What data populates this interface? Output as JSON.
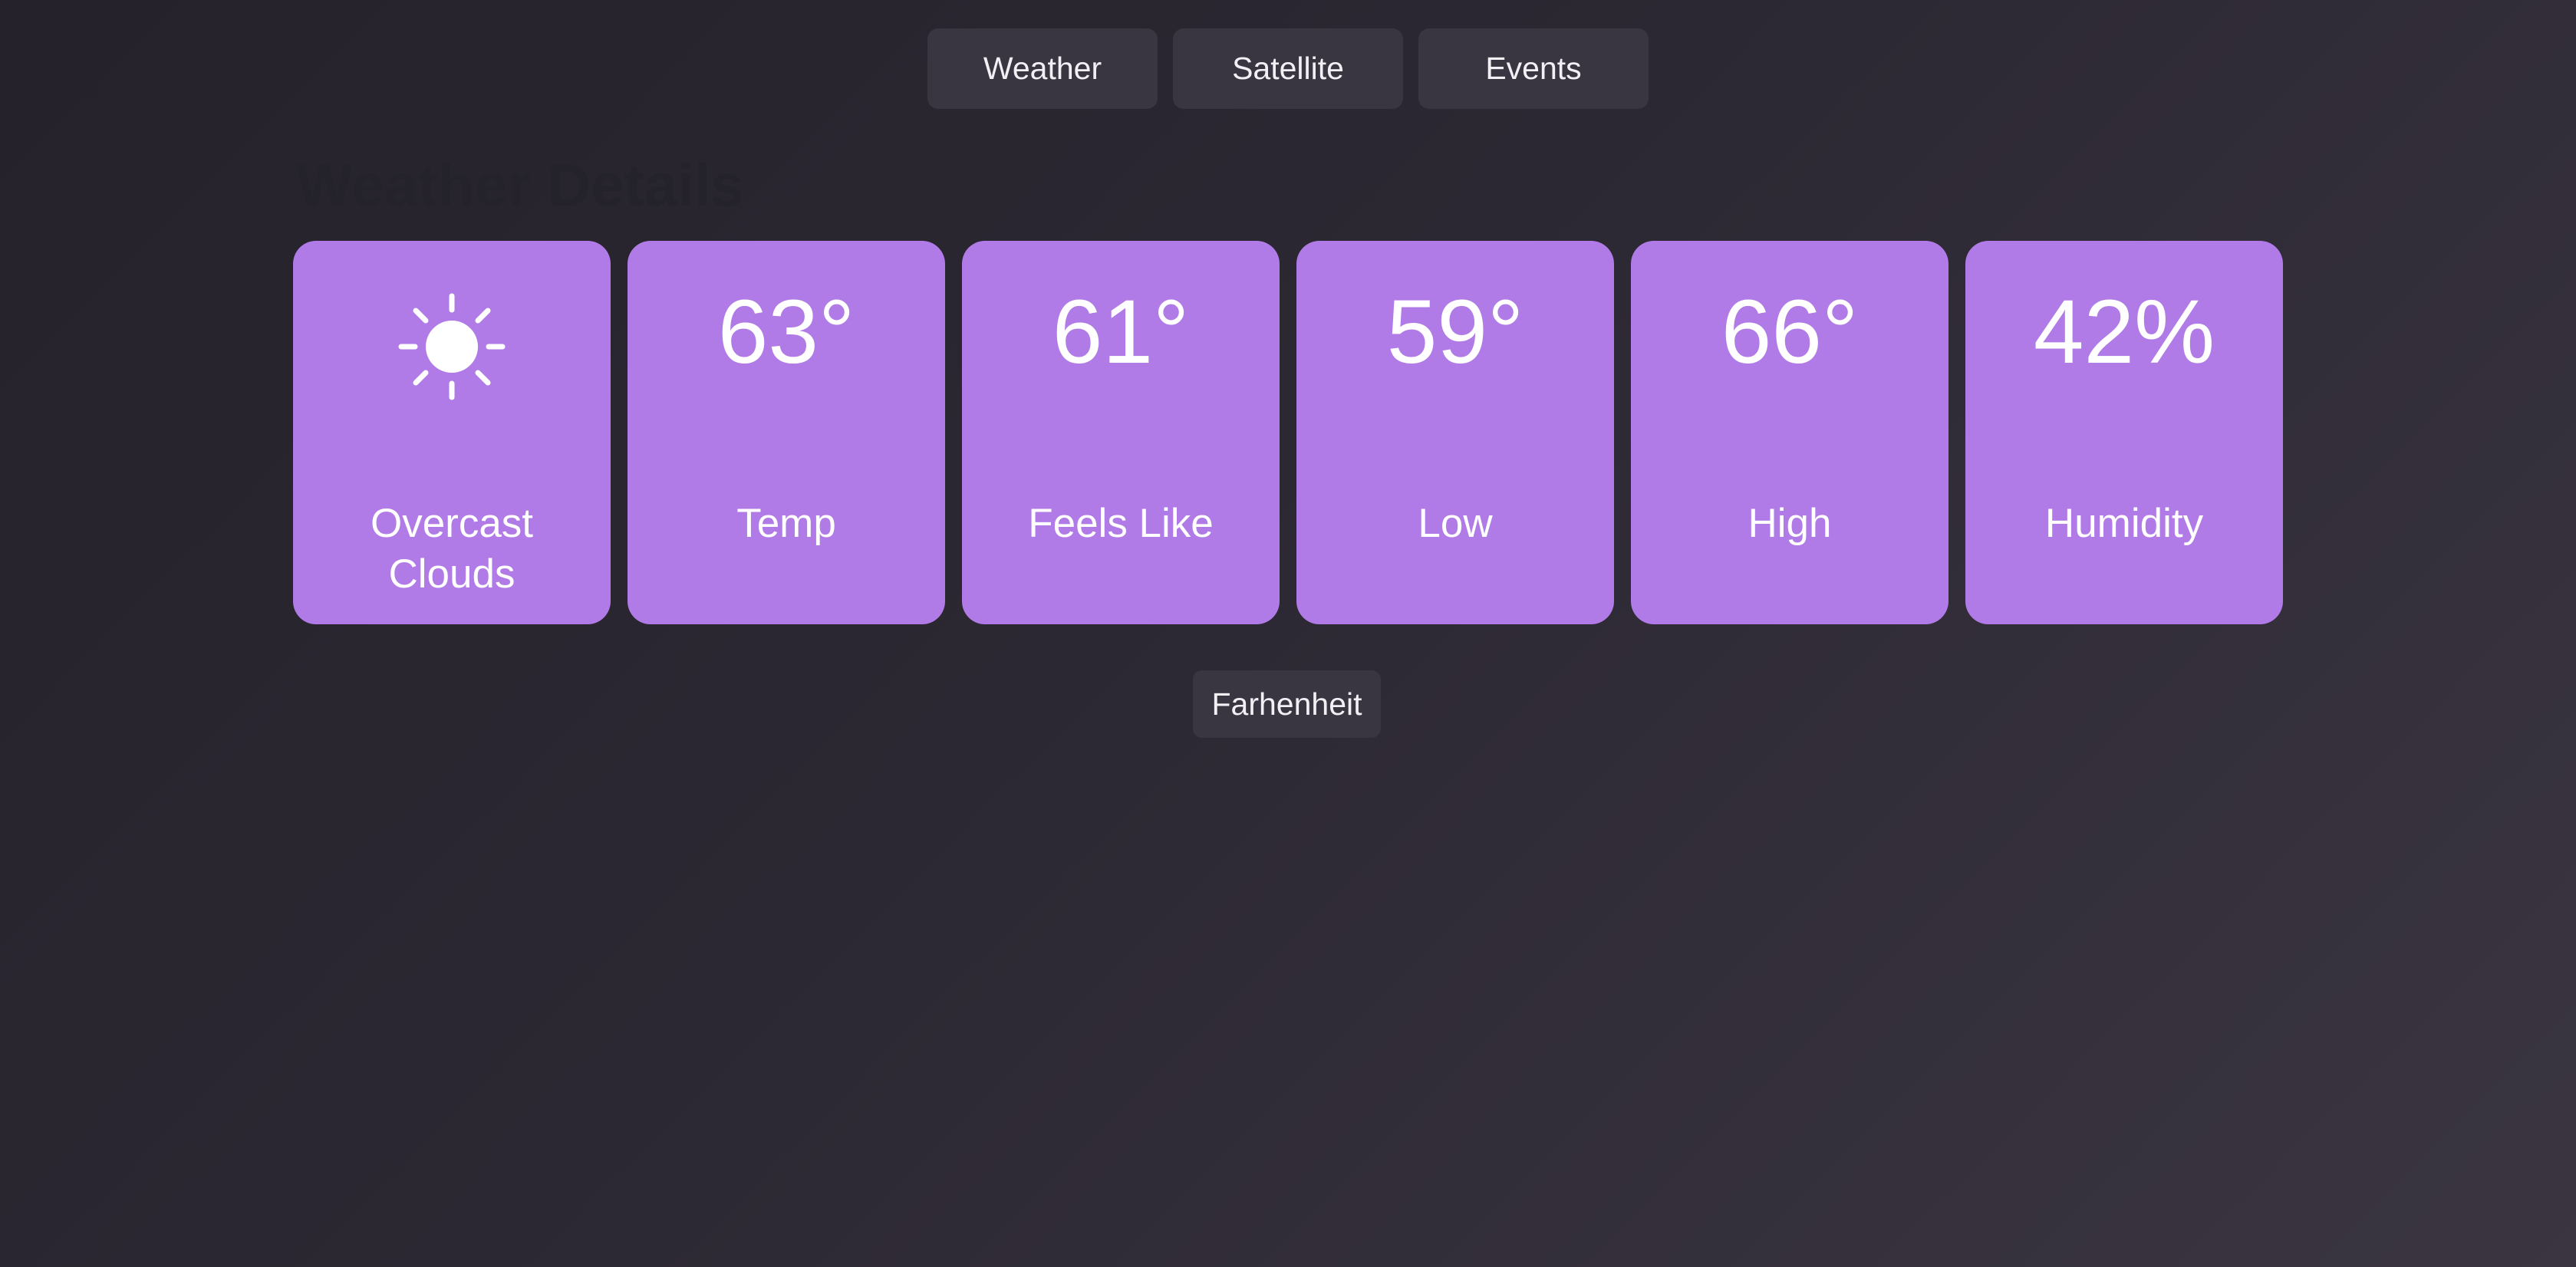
{
  "nav": {
    "tabs": [
      {
        "label": "Weather"
      },
      {
        "label": "Satellite"
      },
      {
        "label": "Events"
      }
    ]
  },
  "section": {
    "title": "Weather Details"
  },
  "cards": [
    {
      "icon": "sun-icon",
      "label": "Overcast Clouds"
    },
    {
      "value": "63°",
      "label": "Temp"
    },
    {
      "value": "61°",
      "label": "Feels Like"
    },
    {
      "value": "59°",
      "label": "Low"
    },
    {
      "value": "66°",
      "label": "High"
    },
    {
      "value": "42%",
      "label": "Humidity"
    }
  ],
  "unit_toggle": {
    "label": "Farhenheit"
  },
  "colors": {
    "card_background": "#b07be6",
    "button_background": "#3a3641"
  }
}
